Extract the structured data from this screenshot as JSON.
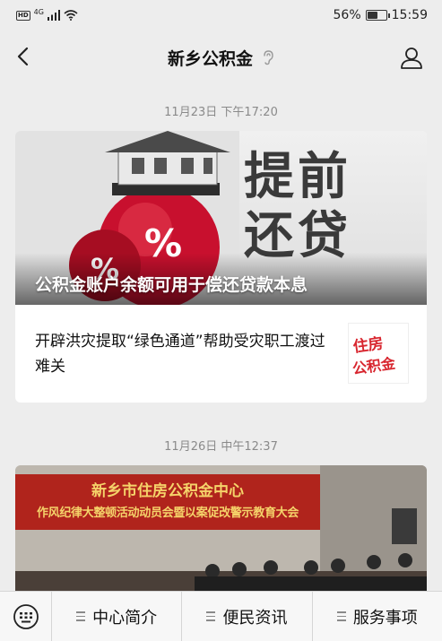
{
  "status": {
    "network": "4G",
    "hd": "HD",
    "battery_percent": "56%",
    "battery_level": 0.56,
    "clock": "15:59"
  },
  "header": {
    "title": "新乡公积金"
  },
  "messages": [
    {
      "time": "11月23日 下午17:20",
      "hero": {
        "caption": "公积金账户余额可用于偿还贷款本息",
        "image_text": [
          "提前",
          "还贷"
        ]
      },
      "item": {
        "title": "开辟洪灾提取“绿色通道”帮助受灾职工渡过难关",
        "thumb_text": [
          "住房",
          "公积金"
        ]
      }
    },
    {
      "time": "11月26日 中午12:37",
      "banner": {
        "line1": "新乡市住房公积金中心",
        "line2": "作风纪律大整顿活动动员会暨以案促改警示教育大会"
      }
    }
  ],
  "bottom_menu": [
    {
      "label": "中心简介"
    },
    {
      "label": "便民资讯"
    },
    {
      "label": "服务事项"
    }
  ],
  "colors": {
    "banner_red": "#b0241c",
    "banner_text": "#f5d36a",
    "hero_red": "#c8102e"
  }
}
